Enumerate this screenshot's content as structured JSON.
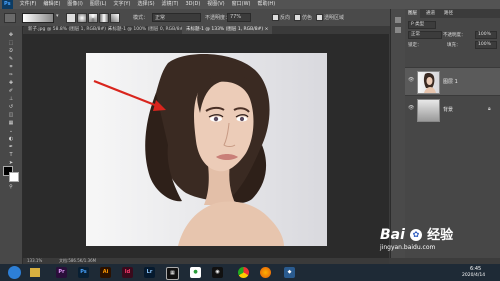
{
  "app": {
    "logo": "Ps"
  },
  "menu": [
    "文件(F)",
    "编辑(E)",
    "图像(I)",
    "图层(L)",
    "文字(Y)",
    "选择(S)",
    "滤镜(T)",
    "3D(D)",
    "视图(V)",
    "窗口(W)",
    "帮助(H)"
  ],
  "options_bar": {
    "mode_label": "模式：",
    "mode_value": "正常",
    "opacity_label": "不透明度：",
    "opacity_value": "77%",
    "reverse_label": "反向",
    "dither_label": "仿色",
    "transparency_label": "透明区域"
  },
  "tabs": [
    {
      "label": "新子.jpg @ 58.8% (图层 1, RGB/8#) ×",
      "active": false
    },
    {
      "label": "未标题-1 @ 100% (图层 0, RGB/8#) ×",
      "active": false
    },
    {
      "label": "未标题-1 @ 133% (图层 1, RGB/8#) ×",
      "active": true
    }
  ],
  "status_bar": {
    "zoom": "133.1%",
    "doc_info": "文档:586.5K/1.36M"
  },
  "layers_panel": {
    "tabs": [
      "图层",
      "通道",
      "路径"
    ],
    "kind_label": "P 类型",
    "blend_mode": "正常",
    "opacity_label": "不透明度：",
    "opacity_value": "100%",
    "lock_label": "锁定：",
    "fill_label": "填充：",
    "fill_value": "100%",
    "layers": [
      {
        "name": "图层 1",
        "selected": true
      },
      {
        "name": "背景",
        "selected": false
      }
    ]
  },
  "taskbar": {
    "time": "6:45",
    "date": "2020/4/14",
    "apps": [
      "pr-icon",
      "ps-icon",
      "ai-icon",
      "id-icon",
      "lr-icon",
      "media-icon",
      "games-icon",
      "qq-icon",
      "chrome-icon",
      "firefox-icon",
      "misc-icon"
    ]
  },
  "watermark": {
    "brand": "Bai",
    "brand2": "经验",
    "url": "jingyan.baidu.com"
  },
  "colors": {
    "accent": "#d9251d",
    "ps_blue": "#47a3ff",
    "panel_bg": "#474747"
  }
}
